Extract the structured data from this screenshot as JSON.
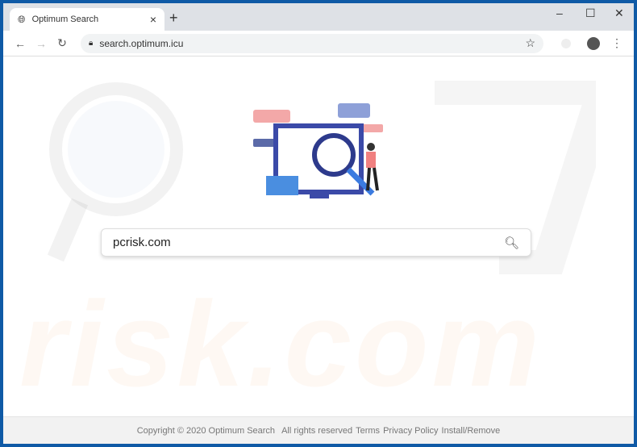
{
  "tab": {
    "title": "Optimum Search",
    "close": "×",
    "new_tab": "+"
  },
  "window_controls": {
    "minimize": "–",
    "maximize": "☐",
    "close": "✕"
  },
  "toolbar": {
    "url": "search.optimum.icu",
    "back": "←",
    "forward": "→",
    "reload": "↻",
    "star": "☆",
    "menu": "⋮"
  },
  "search": {
    "value": "pcrisk.com"
  },
  "watermark": "risk.com",
  "footer": {
    "copyright": "Copyright © 2020 Optimum Search",
    "rights": "All rights reserved",
    "terms": "Terms",
    "privacy": "Privacy Policy",
    "install": "Install/Remove"
  }
}
